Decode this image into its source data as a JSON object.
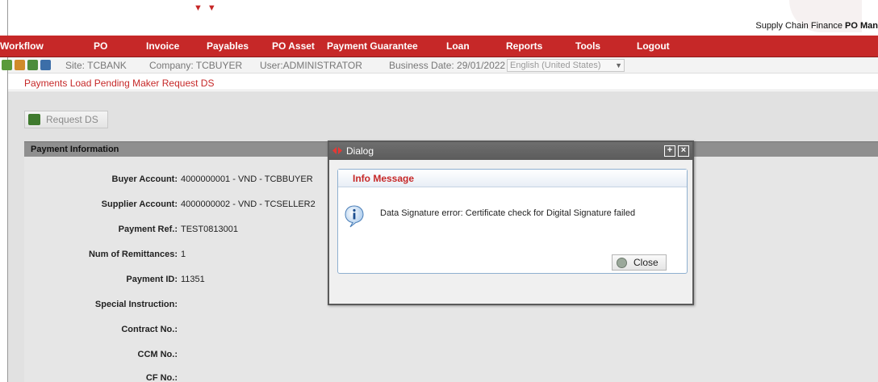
{
  "header": {
    "app_name": "Supply Chain Finance",
    "module": "PO Man"
  },
  "menu": [
    {
      "label": "Workflow"
    },
    {
      "label": "PO"
    },
    {
      "label": "Invoice"
    },
    {
      "label": "Payables"
    },
    {
      "label": "PO Asset"
    },
    {
      "label": "Payment Guarantee"
    },
    {
      "label": "Loan"
    },
    {
      "label": "Reports"
    },
    {
      "label": "Tools"
    },
    {
      "label": "Logout"
    }
  ],
  "context": {
    "site": "Site: TCBANK",
    "company": "Company: TCBUYER",
    "user": "User:ADMINISTRATOR",
    "business_date": "Business Date: 29/01/2022",
    "language": "English (United States)"
  },
  "breadcrumb": "Payments Load Pending Maker Request DS",
  "toolbar": {
    "request_ds_label": "Request DS"
  },
  "payment_info": {
    "section_title": "Payment Information",
    "fields": [
      {
        "label": "Buyer Account:",
        "value": "4000000001 - VND - TCBBUYER"
      },
      {
        "label": "Supplier Account:",
        "value": "4000000002 - VND - TCSELLER2"
      },
      {
        "label": "Payment Ref.:",
        "value": "TEST0813001"
      },
      {
        "label": "Num of Remittances:",
        "value": "1"
      },
      {
        "label": "Payment ID:",
        "value": "11351"
      },
      {
        "label": "Special Instruction:",
        "value": ""
      },
      {
        "label": "Contract No.:",
        "value": ""
      },
      {
        "label": "CCM No.:",
        "value": ""
      },
      {
        "label": "CF No.:",
        "value": ""
      }
    ]
  },
  "dialog": {
    "title": "Dialog",
    "panel_title": "Info Message",
    "message": "Data Signature error: Certificate check for Digital Signature failed",
    "close_label": "Close",
    "maximize_symbol": "+",
    "close_symbol": "×"
  },
  "colors": {
    "brand_red": "#c62828",
    "dialog_title_bg": "#5c5c5c",
    "panel_border": "#8fb0d0"
  }
}
